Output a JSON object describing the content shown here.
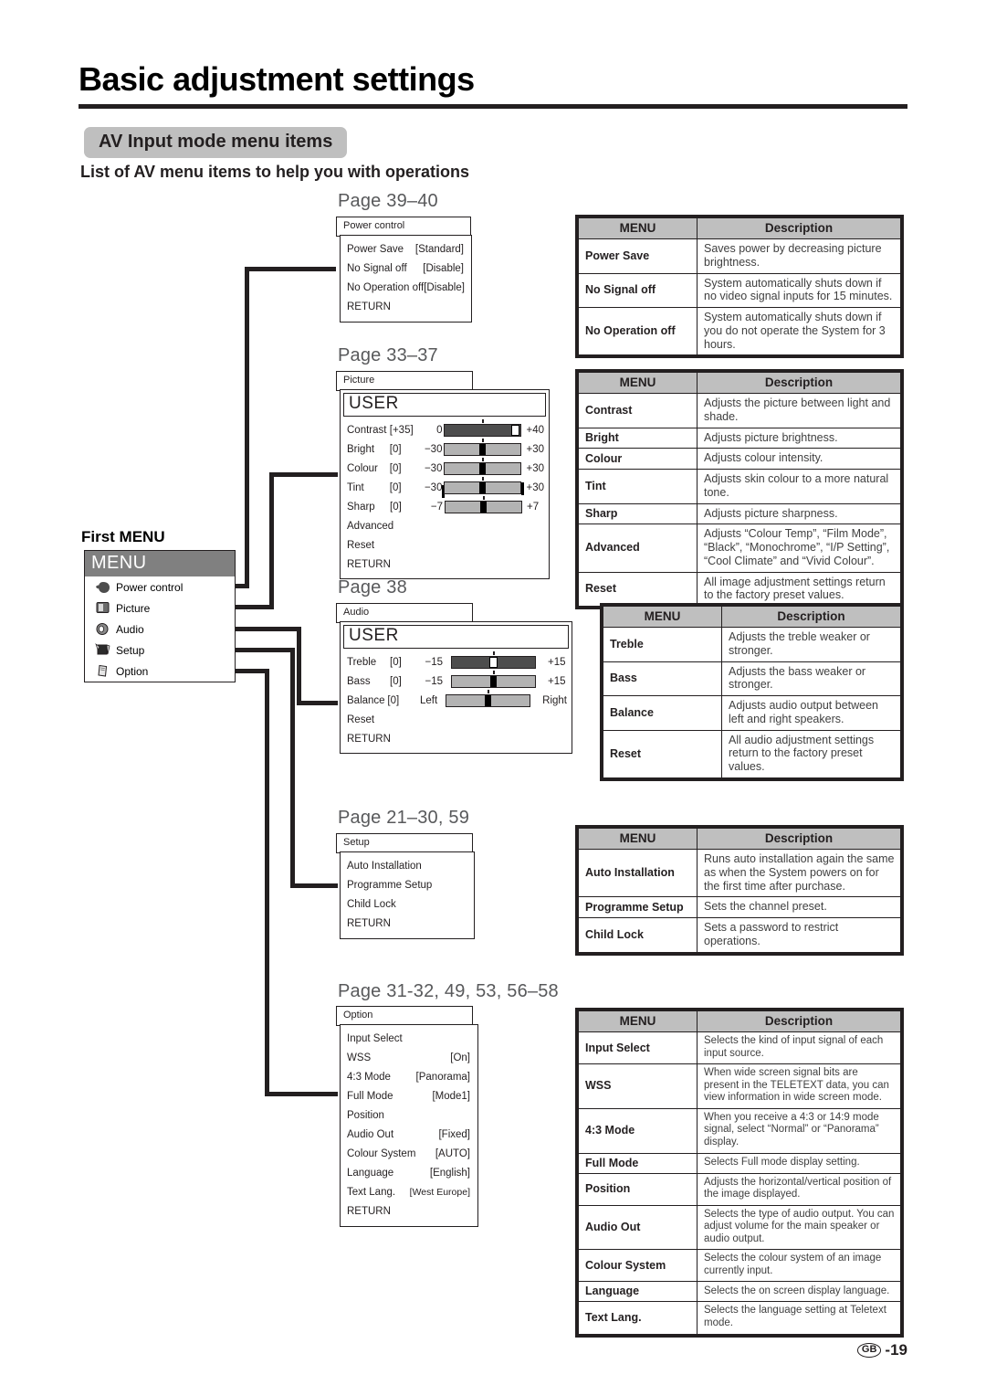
{
  "header": {
    "title": "Basic adjustment settings",
    "section_badge": "AV Input mode menu items",
    "section_sub": "List of AV menu items to help you with operations",
    "badge_bg": "#bfbfbf"
  },
  "first_menu": {
    "label": "First MENU",
    "head": "MENU",
    "head_bg": "#808080",
    "items": [
      {
        "icon": "leaf-icon",
        "label": "Power control"
      },
      {
        "icon": "monitor-icon",
        "label": "Picture"
      },
      {
        "icon": "speaker-icon",
        "label": "Audio"
      },
      {
        "icon": "tools-icon",
        "label": "Setup"
      },
      {
        "icon": "page-icon",
        "label": "Option"
      }
    ]
  },
  "groups": [
    {
      "page_ref": "Page 39–40",
      "osd": {
        "tab": "Power control",
        "rows": [
          {
            "label": "Power Save",
            "value": "[Standard]"
          },
          {
            "label": "No Signal off",
            "value": "[Disable]"
          },
          {
            "label": "No Operation off",
            "value": "[Disable]"
          },
          {
            "label": "RETURN",
            "value": ""
          }
        ]
      },
      "table": {
        "headers": [
          "MENU",
          "Description"
        ],
        "rows": [
          {
            "menu": "Power Save",
            "desc": "Saves power by decreasing picture brightness."
          },
          {
            "menu": "No Signal off",
            "desc": "System automatically shuts down if no video signal inputs for 15 minutes."
          },
          {
            "menu": "No Operation off",
            "desc": "System automatically shuts down if you do not operate the System for 3 hours."
          }
        ]
      }
    },
    {
      "page_ref": "Page 33–37",
      "osd": {
        "tab": "Picture",
        "user_head": "USER",
        "sliders": [
          {
            "name": "Contrast",
            "bracket": "[+35]",
            "min": "0",
            "max": "+40",
            "fill": "dark",
            "knob_pct": 89,
            "tick_pct": 50,
            "endcaps": false,
            "knob_light": true
          },
          {
            "name": "Bright",
            "bracket": "[0]",
            "min": "−30",
            "max": "+30",
            "fill": "light",
            "knob_pct": 50,
            "tick_pct": 50,
            "endcaps": false,
            "knob_light": false
          },
          {
            "name": "Colour",
            "bracket": "[0]",
            "min": "−30",
            "max": "+30",
            "fill": "light",
            "knob_pct": 50,
            "tick_pct": 50,
            "endcaps": false,
            "knob_light": false
          },
          {
            "name": "Tint",
            "bracket": "[0]",
            "min": "−30",
            "max": "+30",
            "fill": "light",
            "knob_pct": 50,
            "tick_pct": 50,
            "endcaps": true,
            "knob_light": false
          },
          {
            "name": "Sharp",
            "bracket": "[0]",
            "min": "−7",
            "max": "+7",
            "fill": "light",
            "knob_pct": 50,
            "tick_pct": 50,
            "endcaps": false,
            "knob_light": false
          }
        ],
        "plain_rows": [
          "Advanced",
          "Reset",
          "RETURN"
        ]
      },
      "table": {
        "headers": [
          "MENU",
          "Description"
        ],
        "rows": [
          {
            "menu": "Contrast",
            "desc": "Adjusts the picture between light and shade."
          },
          {
            "menu": "Bright",
            "desc": "Adjusts picture brightness."
          },
          {
            "menu": "Colour",
            "desc": "Adjusts colour intensity."
          },
          {
            "menu": "Tint",
            "desc": "Adjusts skin colour to a more natural tone."
          },
          {
            "menu": "Sharp",
            "desc": "Adjusts picture sharpness."
          },
          {
            "menu": "Advanced",
            "desc": "Adjusts “Colour Temp”, “Film Mode”, “Black”, “Monochrome”, “I/P Setting”, “Cool Climate” and “Vivid Colour”."
          },
          {
            "menu": "Reset",
            "desc": "All image adjustment settings return to the factory preset values."
          }
        ]
      }
    },
    {
      "page_ref": "Page 38",
      "osd": {
        "tab": "Audio",
        "user_head": "USER",
        "sliders": [
          {
            "name": "Treble",
            "bracket": "[0]",
            "min": "−15",
            "max": "+15",
            "fill": "dark",
            "knob_pct": 50,
            "tick_pct": 50,
            "endcaps": false,
            "knob_light": true
          },
          {
            "name": "Bass",
            "bracket": "[0]",
            "min": "−15",
            "max": "+15",
            "fill": "light",
            "knob_pct": 50,
            "tick_pct": 50,
            "endcaps": false,
            "knob_light": false
          },
          {
            "name": "Balance",
            "bracket": "[0]",
            "min": "Left",
            "max": "Right",
            "fill": "light",
            "knob_pct": 50,
            "tick_pct": 50,
            "endcaps": false,
            "knob_light": false
          }
        ],
        "plain_rows": [
          "Reset",
          "RETURN"
        ]
      },
      "table": {
        "headers": [
          "MENU",
          "Description"
        ],
        "rows": [
          {
            "menu": "Treble",
            "desc": "Adjusts the treble weaker or stronger."
          },
          {
            "menu": "Bass",
            "desc": "Adjusts the bass weaker or stronger."
          },
          {
            "menu": "Balance",
            "desc": "Adjusts audio output between left and right speakers."
          },
          {
            "menu": "Reset",
            "desc": "All audio adjustment settings return to the factory preset values."
          }
        ]
      }
    },
    {
      "page_ref": "Page 21–30, 59",
      "osd": {
        "tab": "Setup",
        "rows": [
          {
            "label": "Auto Installation",
            "value": ""
          },
          {
            "label": "Programme Setup",
            "value": ""
          },
          {
            "label": "Child Lock",
            "value": ""
          },
          {
            "label": "RETURN",
            "value": ""
          }
        ]
      },
      "table": {
        "headers": [
          "MENU",
          "Description"
        ],
        "rows": [
          {
            "menu": "Auto Installation",
            "desc": "Runs auto installation again the same as when the System powers on for the first time after purchase."
          },
          {
            "menu": "Programme Setup",
            "desc": "Sets the channel preset."
          },
          {
            "menu": "Child Lock",
            "desc": "Sets a password to restrict operations."
          }
        ]
      }
    },
    {
      "page_ref": "Page 31-32, 49, 53, 56–58",
      "osd": {
        "tab": "Option",
        "rows": [
          {
            "label": "Input Select",
            "value": ""
          },
          {
            "label": "WSS",
            "value": "[On]"
          },
          {
            "label": "4:3 Mode",
            "value": "[Panorama]"
          },
          {
            "label": "Full Mode",
            "value": "[Mode1]"
          },
          {
            "label": "Position",
            "value": ""
          },
          {
            "label": "Audio Out",
            "value": "[Fixed]"
          },
          {
            "label": "Colour System",
            "value": "[AUTO]"
          },
          {
            "label": "Language",
            "value": "[English]"
          },
          {
            "label": "Text Lang.",
            "value": "[West Europe]"
          },
          {
            "label": "RETURN",
            "value": ""
          }
        ]
      },
      "table": {
        "headers": [
          "MENU",
          "Description"
        ],
        "rows": [
          {
            "menu": "Input Select",
            "desc": "Selects the kind of input signal of each input source."
          },
          {
            "menu": "WSS",
            "desc": "When wide screen signal bits are present in the TELETEXT data, you can view information in wide screen mode."
          },
          {
            "menu": "4:3 Mode",
            "desc": "When you receive a 4:3 or 14:9 mode signal, select “Normal” or “Panorama” display."
          },
          {
            "menu": "Full Mode",
            "desc": "Selects Full mode display setting."
          },
          {
            "menu": "Position",
            "desc": "Adjusts the horizontal/vertical position of the image displayed."
          },
          {
            "menu": "Audio Out",
            "desc": "Selects the type of audio output. You can adjust volume for the main speaker or audio output."
          },
          {
            "menu": "Colour System",
            "desc": "Selects the colour system of an image currently input."
          },
          {
            "menu": "Language",
            "desc": "Selects the on screen display language."
          },
          {
            "menu": "Text Lang.",
            "desc": "Selects the language setting at Teletext mode."
          }
        ]
      }
    }
  ],
  "footer": {
    "region": "GB",
    "page_number": "-19"
  }
}
